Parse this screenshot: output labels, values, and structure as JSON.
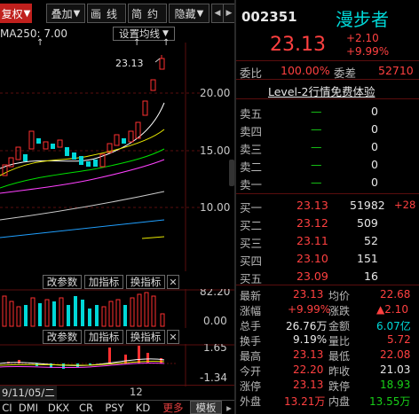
{
  "toolbar": {
    "fuquan": "复权",
    "fuquan_arrow": "▼",
    "diejia": "叠加",
    "diejia_arrow": "▼",
    "xianxian": "画线",
    "jianyue": "简约",
    "yincang": "隐藏",
    "yincang_arrow": "▼"
  },
  "chart": {
    "ma_label": "MA250: 7.00",
    "ma_arrow": "↑",
    "set_ma": "设置均线",
    "set_ma_arrow": "▼",
    "high_label": "23.13",
    "price_ticks": [
      "20.00",
      "15.00",
      "10.00"
    ],
    "sub1": {
      "change_params": "改参数",
      "add_indicator": "加指标",
      "switch_indicator": "换指标",
      "close": "✕",
      "ticks": [
        "82.20",
        "0.00"
      ]
    },
    "sub2": {
      "change_params": "改参数",
      "add_indicator": "加指标",
      "switch_indicator": "换指标",
      "close": "✕",
      "ticks": [
        "1.65",
        "-1.34"
      ]
    },
    "date_label": "9/11/05/二",
    "month_label": "12"
  },
  "bottom_tabs": [
    "CI",
    "DMI",
    "DKX",
    "CR",
    "PSY",
    "KD",
    "更多",
    "模板"
  ],
  "bottom_tabs_gt": "▸",
  "stock": {
    "code": "002351",
    "name": "漫步者",
    "price": "23.13",
    "change": "+2.10",
    "change_pct": "+9.99%"
  },
  "orderbook_head": {
    "weibi_label": "委比",
    "weibi": "100.00%",
    "weicha_label": "委差",
    "weicha": "52710",
    "level2": "Level-2行情免费体验"
  },
  "sell": [
    {
      "label": "卖五",
      "price": "—",
      "vol": "0"
    },
    {
      "label": "卖四",
      "price": "—",
      "vol": "0"
    },
    {
      "label": "卖三",
      "price": "—",
      "vol": "0"
    },
    {
      "label": "卖二",
      "price": "—",
      "vol": "0"
    },
    {
      "label": "卖一",
      "price": "—",
      "vol": "0"
    }
  ],
  "buy": [
    {
      "label": "买一",
      "price": "23.13",
      "vol": "51982",
      "extra": "+28"
    },
    {
      "label": "买二",
      "price": "23.12",
      "vol": "509",
      "extra": ""
    },
    {
      "label": "买三",
      "price": "23.11",
      "vol": "52",
      "extra": ""
    },
    {
      "label": "买四",
      "price": "23.10",
      "vol": "151",
      "extra": ""
    },
    {
      "label": "买五",
      "price": "23.09",
      "vol": "16",
      "extra": ""
    }
  ],
  "quote": [
    {
      "l1": "最新",
      "v1": "23.13",
      "l2": "均价",
      "v2": "22.68",
      "c1": "red",
      "c2": "red"
    },
    {
      "l1": "涨幅",
      "v1": "+9.99%",
      "l2": "涨跌",
      "v2": "▲2.10",
      "c1": "red",
      "c2": "red"
    },
    {
      "l1": "总手",
      "v1": "26.76万",
      "l2": "金额",
      "v2": "6.07亿",
      "c1": "white",
      "c2": "cyan"
    },
    {
      "l1": "换手",
      "v1": "9.19%",
      "l2": "量比",
      "v2": "5.72",
      "c1": "white",
      "c2": "red"
    },
    {
      "l1": "最高",
      "v1": "23.13",
      "l2": "最低",
      "v2": "22.08",
      "c1": "red",
      "c2": "red"
    },
    {
      "l1": "今开",
      "v1": "22.20",
      "l2": "昨收",
      "v2": "21.03",
      "c1": "red",
      "c2": "white"
    },
    {
      "l1": "涨停",
      "v1": "23.13",
      "l2": "跌停",
      "v2": "18.93",
      "c1": "red",
      "c2": "green"
    },
    {
      "l1": "外盘",
      "v1": "13.21万",
      "l2": "内盘",
      "v2": "13.55万",
      "c1": "red",
      "c2": "green"
    }
  ],
  "colors": {
    "up": "#ff3030",
    "down": "#00d8d8",
    "accent": "#c0201d"
  }
}
